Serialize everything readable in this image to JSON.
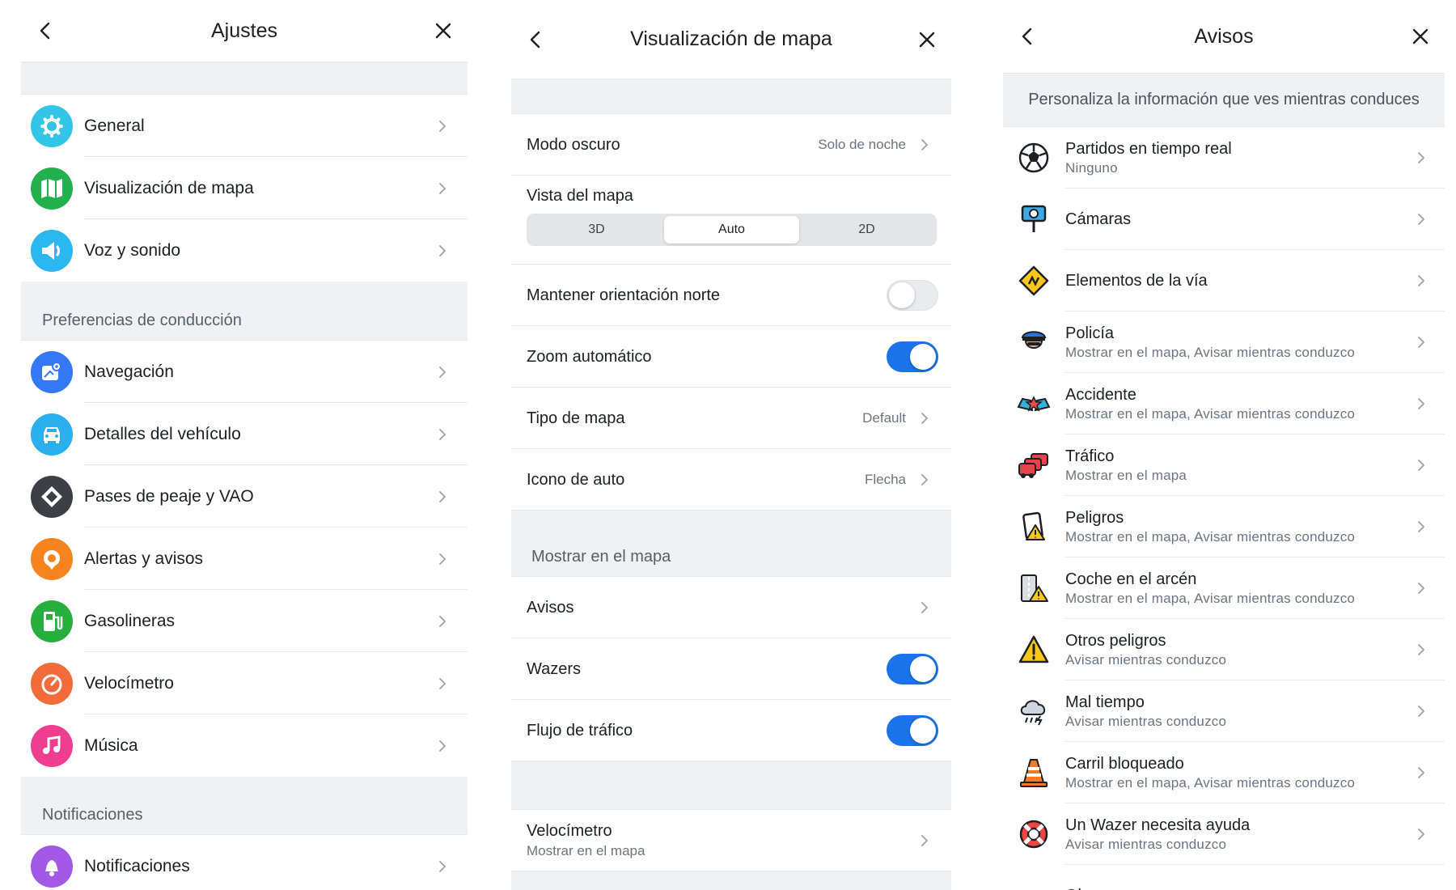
{
  "panel1": {
    "title": "Ajustes",
    "items_top": [
      {
        "label": "General",
        "icon": "gear-icon",
        "color": "#33c5e8"
      },
      {
        "label": "Visualización de mapa",
        "icon": "map-icon",
        "color": "#22b14c"
      },
      {
        "label": "Voz y sonido",
        "icon": "speaker-icon",
        "color": "#2bb8f0"
      }
    ],
    "section_driving": "Preferencias de conducción",
    "items_driving": [
      {
        "label": "Navegación",
        "icon": "navigation-icon",
        "color": "#3478f6"
      },
      {
        "label": "Detalles del vehículo",
        "icon": "car-icon",
        "color": "#2bb0ee"
      },
      {
        "label": "Pases de peaje y VAO",
        "icon": "toll-icon",
        "color": "#3c4046"
      },
      {
        "label": "Alertas y avisos",
        "icon": "alert-icon",
        "color": "#f7841e"
      },
      {
        "label": "Gasolineras",
        "icon": "fuel-icon",
        "color": "#27ae3f"
      },
      {
        "label": "Velocímetro",
        "icon": "speedometer-icon",
        "color": "#f26b3a"
      },
      {
        "label": "Música",
        "icon": "music-icon",
        "color": "#ef3d8f"
      }
    ],
    "section_notif": "Notificaciones",
    "items_notif": [
      {
        "label": "Notificaciones",
        "icon": "bell-icon",
        "color": "#a259e6"
      }
    ]
  },
  "panel2": {
    "title": "Visualización de mapa",
    "dark_mode": {
      "label": "Modo oscuro",
      "value": "Solo de noche"
    },
    "map_view": {
      "label": "Vista del mapa",
      "options": [
        "3D",
        "Auto",
        "2D"
      ],
      "selected": "Auto"
    },
    "north": {
      "label": "Mantener orientación norte",
      "on": false
    },
    "zoom": {
      "label": "Zoom automático",
      "on": true
    },
    "map_type": {
      "label": "Tipo de mapa",
      "value": "Default"
    },
    "car_icon": {
      "label": "Icono de auto",
      "value": "Flecha"
    },
    "section_show": "Mostrar en el mapa",
    "avisos": {
      "label": "Avisos"
    },
    "wazers": {
      "label": "Wazers",
      "on": true
    },
    "traffic": {
      "label": "Flujo de tráfico",
      "on": true
    },
    "speedometer": {
      "label": "Velocímetro",
      "sub": "Mostrar en el mapa"
    }
  },
  "panel3": {
    "title": "Avisos",
    "info": "Personaliza la información que ves mientras conduces",
    "items": [
      {
        "label": "Partidos en tiempo real",
        "sub": "Ninguno",
        "icon": "soccer-ball-icon"
      },
      {
        "label": "Cámaras",
        "sub": "",
        "icon": "camera-icon"
      },
      {
        "label": "Elementos de la vía",
        "sub": "",
        "icon": "road-sign-icon"
      },
      {
        "label": "Policía",
        "sub": "Mostrar en el mapa, Avisar mientras conduzco",
        "icon": "police-icon"
      },
      {
        "label": "Accidente",
        "sub": "Mostrar en el mapa, Avisar mientras conduzco",
        "icon": "crash-icon"
      },
      {
        "label": "Tráfico",
        "sub": "Mostrar en el mapa",
        "icon": "traffic-icon"
      },
      {
        "label": "Peligros",
        "sub": "Mostrar en el mapa, Avisar mientras conduzco",
        "icon": "hazard-icon"
      },
      {
        "label": "Coche en el arcén",
        "sub": "Mostrar en el mapa, Avisar mientras conduzco",
        "icon": "shoulder-car-icon"
      },
      {
        "label": "Otros peligros",
        "sub": "Avisar mientras conduzco",
        "icon": "warning-icon"
      },
      {
        "label": "Mal tiempo",
        "sub": "Avisar mientras conduzco",
        "icon": "storm-icon"
      },
      {
        "label": "Carril bloqueado",
        "sub": "Mostrar en el mapa, Avisar mientras conduzco",
        "icon": "cone-icon"
      },
      {
        "label": "Un Wazer necesita ayuda",
        "sub": "Avisar mientras conduzco",
        "icon": "lifebuoy-icon"
      },
      {
        "label": "Obras",
        "sub": "",
        "icon": "hardhat-icon"
      }
    ]
  }
}
